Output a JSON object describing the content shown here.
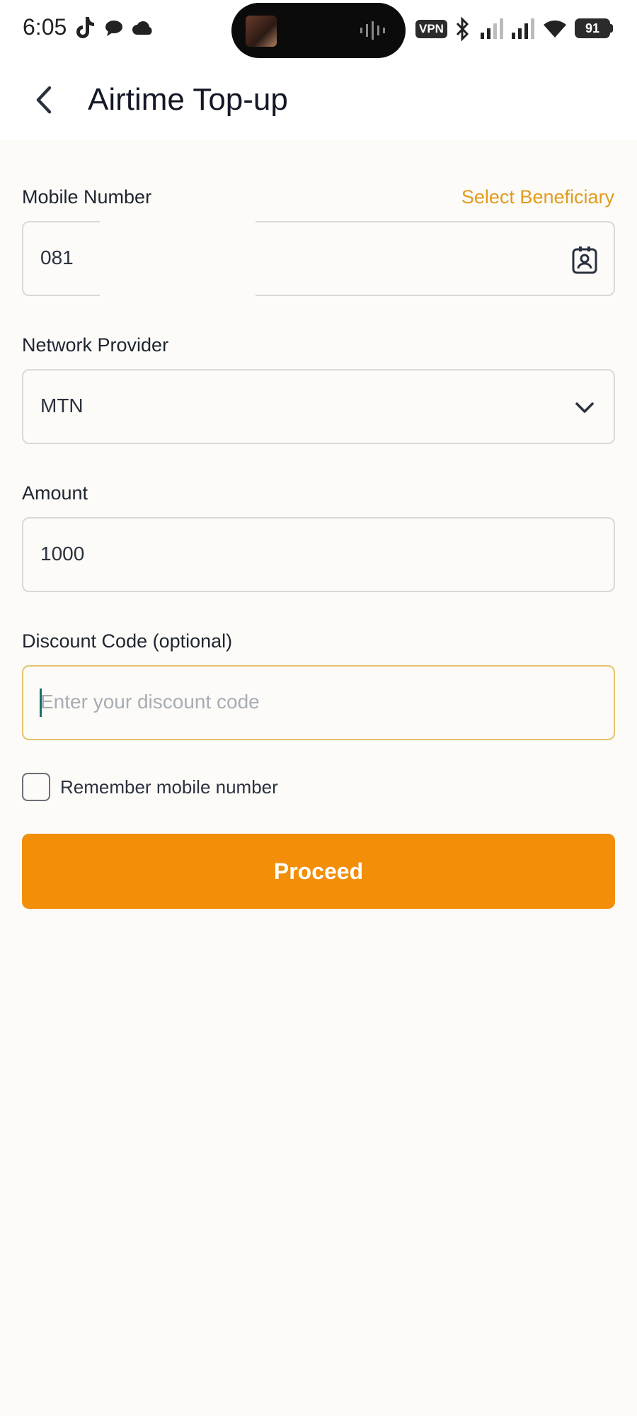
{
  "status_bar": {
    "time": "6:05",
    "vpn_label": "VPN",
    "battery_level": "91",
    "icons": [
      "tiktok-icon",
      "chat-bubble-icon",
      "cloud-icon",
      "bluetooth-icon",
      "signal-icon",
      "signal-icon",
      "wifi-icon",
      "battery-icon"
    ]
  },
  "header": {
    "title": "Airtime Top-up",
    "back_icon": "back-arrow-icon"
  },
  "form": {
    "mobile_number": {
      "label": "Mobile Number",
      "link": "Select Beneficiary",
      "value": "081",
      "icon": "contact-icon"
    },
    "network_provider": {
      "label": "Network Provider",
      "value": "MTN",
      "icon": "chevron-down-icon"
    },
    "amount": {
      "label": "Amount",
      "value": "1000"
    },
    "discount_code": {
      "label": "Discount Code (optional)",
      "placeholder": "Enter your discount code"
    },
    "remember": {
      "label": "Remember mobile number",
      "checked": false
    },
    "proceed_label": "Proceed"
  },
  "colors": {
    "accent": "#f28e08",
    "link": "#e39a1c",
    "background": "#fcfbf8",
    "focus_border": "#e6c36a"
  }
}
